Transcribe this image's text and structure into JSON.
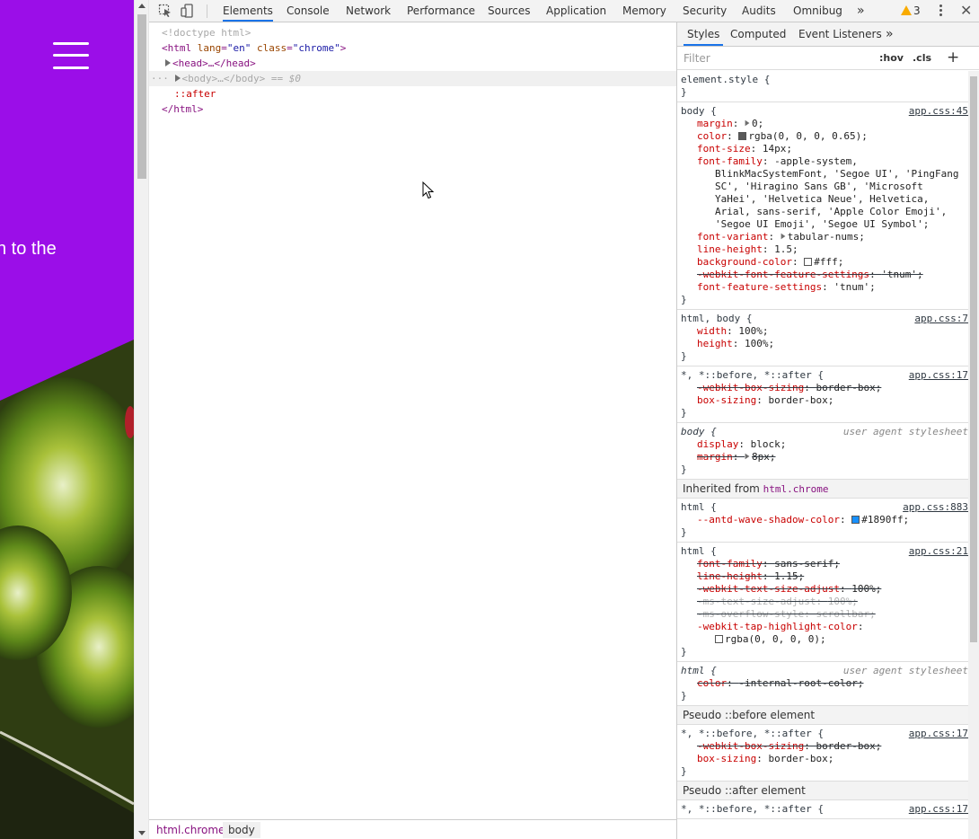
{
  "page_preview": {
    "hero_text": "n to the",
    "colors": {
      "hero": "#9b0ee8"
    }
  },
  "toolbar": {
    "tabs": [
      "Elements",
      "Console",
      "Network",
      "Performance",
      "Sources",
      "Application",
      "Memory",
      "Security",
      "Audits",
      "Omnibug"
    ],
    "more": "»",
    "warning_count": "3"
  },
  "dom": {
    "doctype": "<!doctype html>",
    "html_tag_open": "<html",
    "html_lang_attr": "lang",
    "html_lang_val": "\"en\"",
    "html_class_attr": "class",
    "html_class_val": "\"chrome\"",
    "html_tag_close_bracket": ">",
    "head_line": "<head>…</head>",
    "body_line": "<body>…</body>",
    "body_eq": "== $0",
    "row_dots": "···",
    "after": "::after",
    "html_close": "</html>"
  },
  "breadcrumbs": [
    "html.chrome",
    "body"
  ],
  "styles": {
    "subtabs": [
      "Styles",
      "Computed",
      "Event Listeners",
      "»"
    ],
    "filter_placeholder": "Filter",
    "hov": ":hov",
    "cls": ".cls",
    "add": "+",
    "element_style": {
      "selector": "element.style {",
      "close": "}"
    },
    "rules": [
      {
        "selector": "body {",
        "source": "app.css:45",
        "props": [
          {
            "name": "margin",
            "value": "0;",
            "arrow": true
          },
          {
            "name": "color",
            "value": "rgba(0, 0, 0, 0.65);",
            "swatch": "#595959"
          },
          {
            "name": "font-size",
            "value": "14px;"
          },
          {
            "name": "font-family",
            "value": "-apple-system,"
          },
          {
            "cont": "BlinkMacSystemFont, 'Segoe UI', 'PingFang"
          },
          {
            "cont": "SC', 'Hiragino Sans GB', 'Microsoft"
          },
          {
            "cont": "YaHei', 'Helvetica Neue', Helvetica,"
          },
          {
            "cont": "Arial, sans-serif, 'Apple Color Emoji',"
          },
          {
            "cont": "'Segoe UI Emoji', 'Segoe UI Symbol';"
          },
          {
            "name": "font-variant",
            "value": "tabular-nums;",
            "arrow": true
          },
          {
            "name": "line-height",
            "value": "1.5;"
          },
          {
            "name": "background-color",
            "value": "#fff;",
            "swatch": "#ffffff"
          },
          {
            "name": "-webkit-font-feature-settings",
            "value": "'tnum';",
            "strike": true
          },
          {
            "name": "font-feature-settings",
            "value": "'tnum';"
          }
        ]
      },
      {
        "selector": "html, body {",
        "source": "app.css:7",
        "props": [
          {
            "name": "width",
            "value": "100%;"
          },
          {
            "name": "height",
            "value": "100%;"
          }
        ]
      },
      {
        "selector": "*, *::before, *::after {",
        "source": "app.css:17",
        "props": [
          {
            "name": "-webkit-box-sizing",
            "value": "border-box;",
            "strike": true
          },
          {
            "name": "box-sizing",
            "value": "border-box;"
          }
        ]
      },
      {
        "selector": "body {",
        "source": "user agent stylesheet",
        "ua": true,
        "props": [
          {
            "name": "display",
            "value": "block;"
          },
          {
            "name": "margin",
            "value": "8px;",
            "strike": true,
            "arrow": true
          }
        ]
      }
    ],
    "inherited_label": "Inherited from",
    "inherited_from": "html.chrome",
    "inherited_rules": [
      {
        "selector": "html {",
        "source": "app.css:883",
        "props": [
          {
            "name": "--antd-wave-shadow-color",
            "value": "#1890ff;",
            "swatch": "#1890ff"
          }
        ]
      },
      {
        "selector": "html {",
        "source": "app.css:21",
        "props": [
          {
            "name": "font-family",
            "value": "sans-serif;",
            "strike": true
          },
          {
            "name": "line-height",
            "value": "1.15;",
            "strike": true
          },
          {
            "name": "-webkit-text-size-adjust",
            "value": "100%;",
            "strike": true
          },
          {
            "name": "-ms-text-size-adjust",
            "value": "100%;",
            "strike": true,
            "faded": true
          },
          {
            "name": "-ms-overflow-style",
            "value": "scrollbar;",
            "strike": true,
            "faded": true
          },
          {
            "name": "-webkit-tap-highlight-color",
            "value": ""
          },
          {
            "cont": "rgba(0, 0, 0, 0);",
            "swatch": "#ffffff"
          }
        ]
      },
      {
        "selector": "html {",
        "source": "user agent stylesheet",
        "ua": true,
        "props": [
          {
            "name": "color",
            "value": "-internal-root-color;",
            "strike": true
          }
        ]
      }
    ],
    "pseudo_before_label": "Pseudo ::before element",
    "pseudo_before_rule": {
      "selector": "*, *::before, *::after {",
      "source": "app.css:17",
      "props": [
        {
          "name": "-webkit-box-sizing",
          "value": "border-box;",
          "strike": true
        },
        {
          "name": "box-sizing",
          "value": "border-box;"
        }
      ]
    },
    "pseudo_after_label": "Pseudo ::after element",
    "pseudo_after_rule": {
      "selector": "*, *::before, *::after {",
      "source": "app.css:17",
      "props": []
    }
  }
}
